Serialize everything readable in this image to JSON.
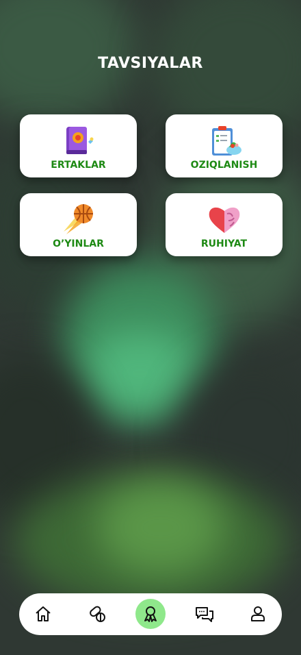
{
  "header": {
    "title": "TAVSIYALAR"
  },
  "cards": [
    {
      "label": "ERTAKLAR",
      "icon": "storybook-icon"
    },
    {
      "label": "OZIQLANISH",
      "icon": "nutrition-clipboard-icon"
    },
    {
      "label": "O’YINLAR",
      "icon": "basketball-icon"
    },
    {
      "label": "RUHIYAT",
      "icon": "heart-brain-icon"
    }
  ],
  "bottom_nav": {
    "items": [
      {
        "name": "home",
        "icon": "home-icon"
      },
      {
        "name": "pills",
        "icon": "pills-icon"
      },
      {
        "name": "recommendations",
        "icon": "award-ribbon-icon",
        "active": true
      },
      {
        "name": "chat",
        "icon": "chat-icon"
      },
      {
        "name": "profile",
        "icon": "user-icon"
      }
    ],
    "active_color": "#8fe88b"
  },
  "colors": {
    "accent_text": "#1e8a14",
    "background": "#2f3833"
  }
}
